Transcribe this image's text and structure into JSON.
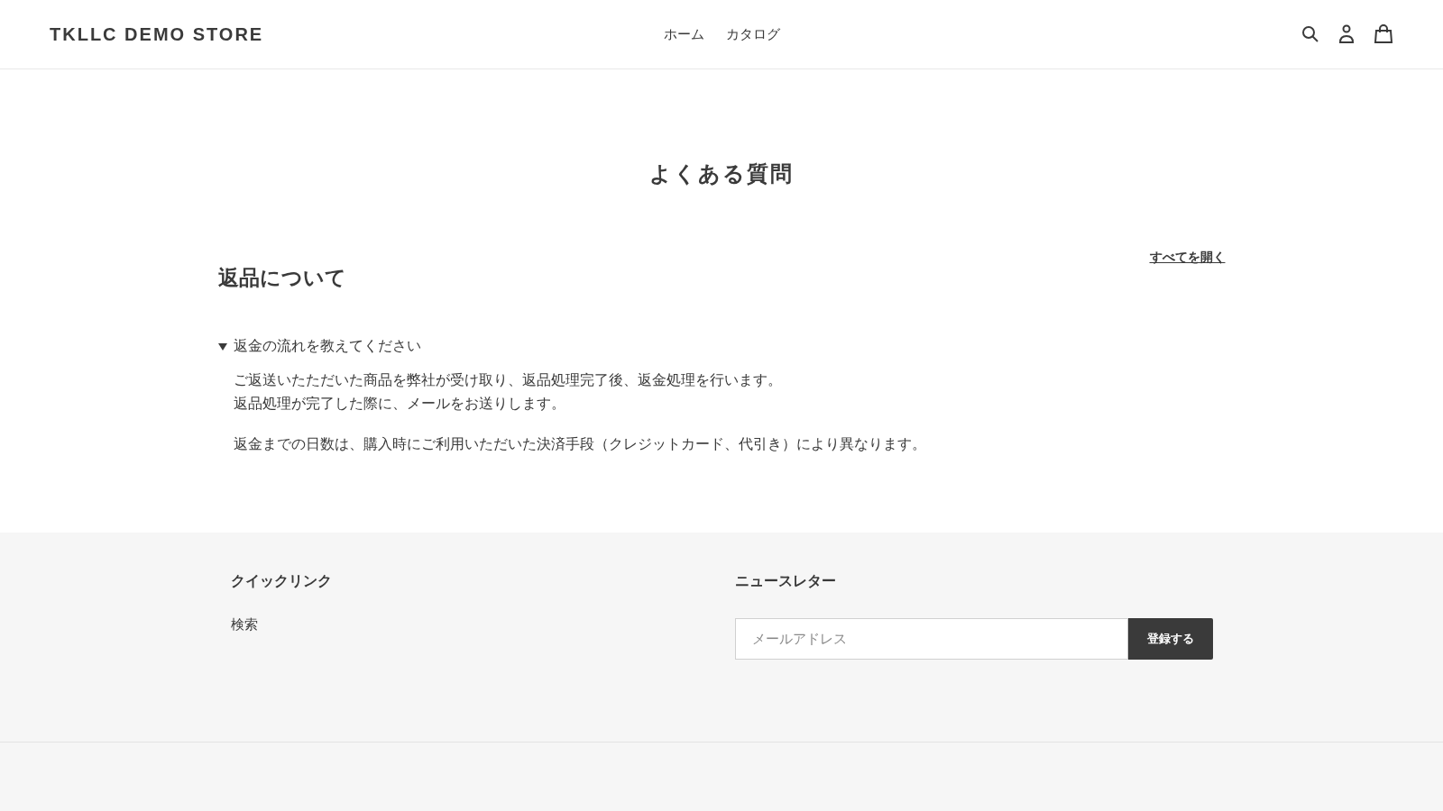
{
  "header": {
    "logo": "TKLLC DEMO STORE",
    "nav": [
      {
        "label": "ホーム"
      },
      {
        "label": "カタログ"
      }
    ]
  },
  "page_title": "よくある質問",
  "expand_all": "すべてを開く",
  "section": {
    "title": "返品について",
    "questions": [
      {
        "question": "返金の流れを教えてください",
        "expanded": true,
        "paragraphs": [
          [
            "ご返送いたただいた商品を弊社が受け取り、返品処理完了後、返金処理を行います。",
            "返品処理が完了した際に、メールをお送りします。"
          ],
          [
            "返金までの日数は、購入時にご利用いただいた決済手段（クレジットカード、代引き）により異なります。"
          ]
        ]
      }
    ]
  },
  "footer": {
    "quick_links": {
      "title": "クイックリンク",
      "links": [
        "検索"
      ]
    },
    "newsletter": {
      "title": "ニュースレター",
      "placeholder": "メールアドレス",
      "button": "登録する"
    }
  }
}
